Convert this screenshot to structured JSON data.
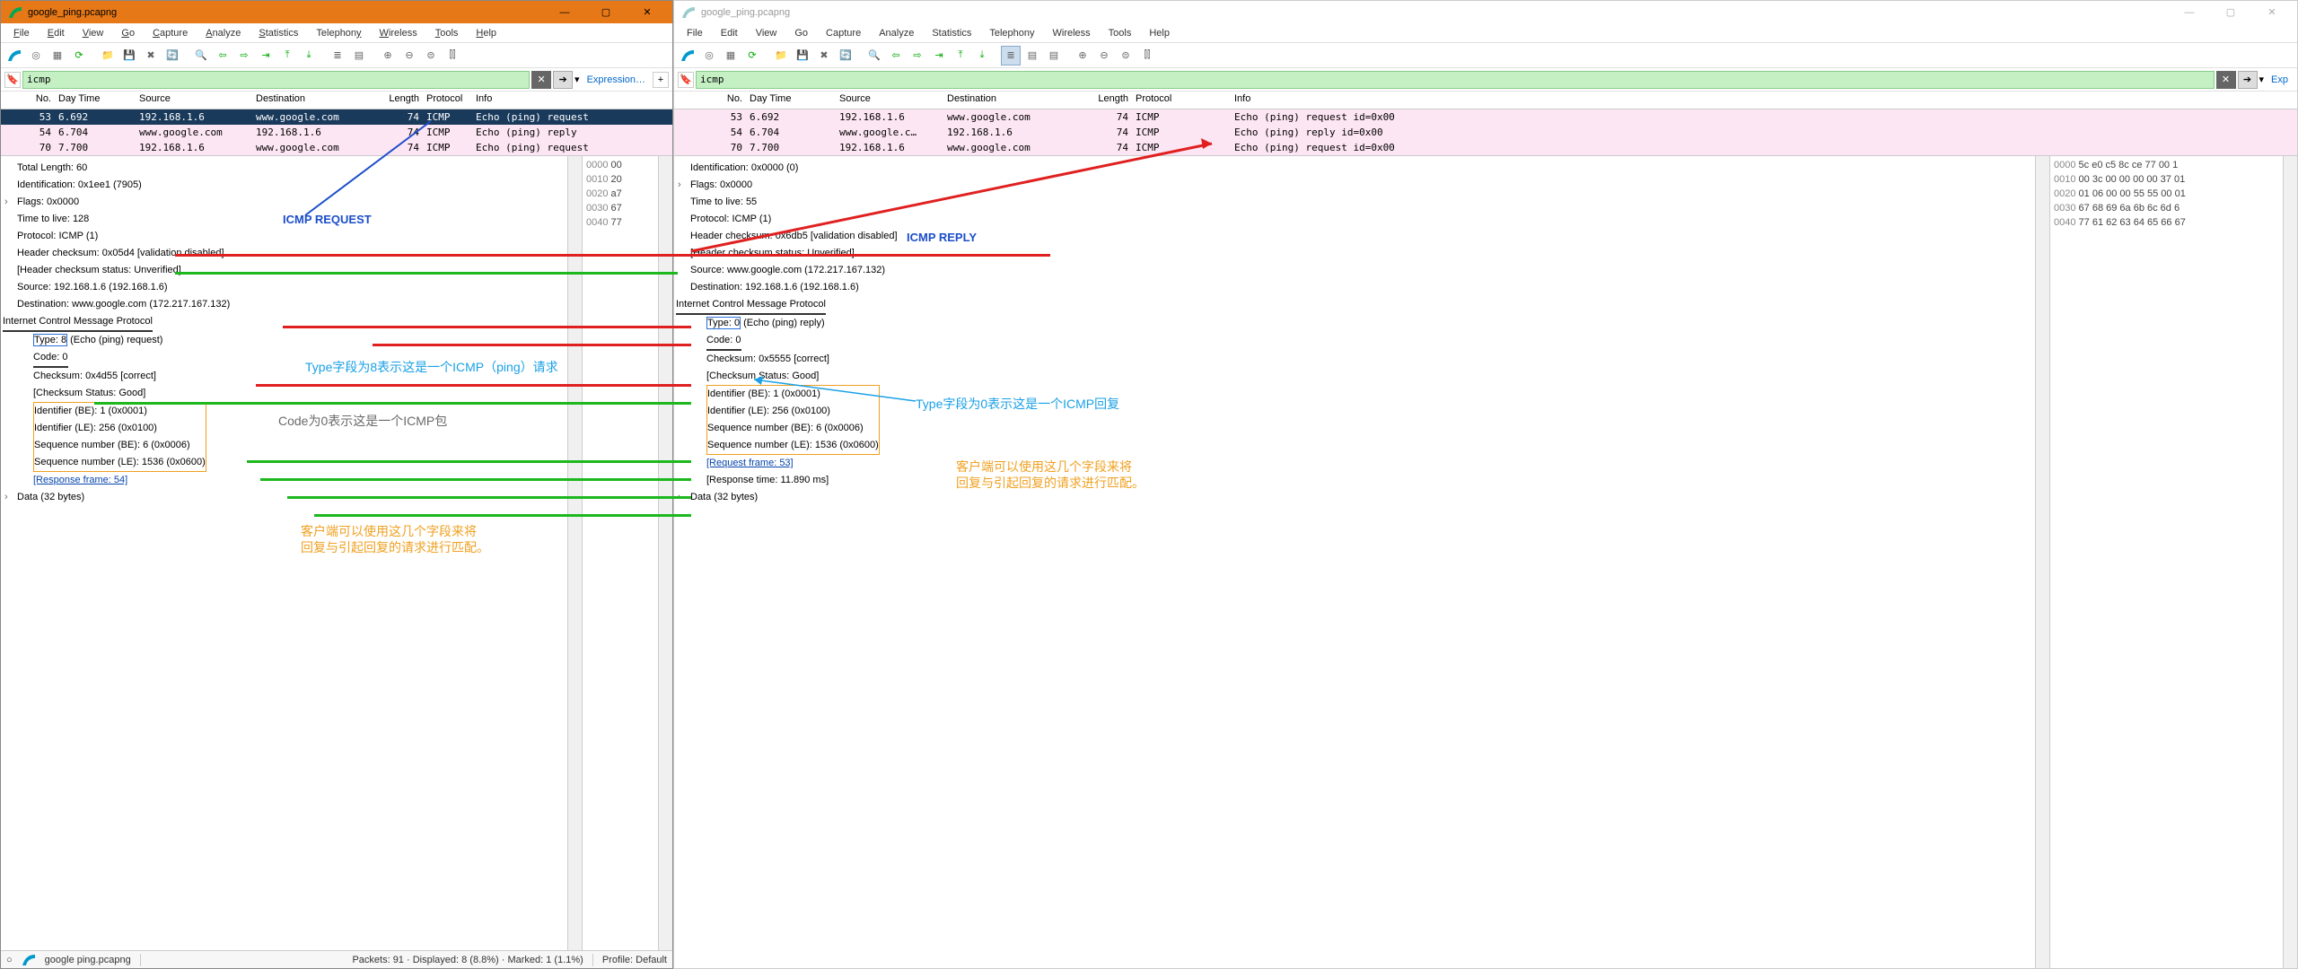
{
  "shared": {
    "title": "google_ping.pcapng",
    "menus": [
      "File",
      "Edit",
      "View",
      "Go",
      "Capture",
      "Analyze",
      "Statistics",
      "Telephony",
      "Wireless",
      "Tools",
      "Help"
    ],
    "filter_value": "icmp",
    "filter_expr": "Expression…",
    "columns": [
      "No.",
      "Day Time",
      "Source",
      "Destination",
      "Length",
      "Protocol",
      "Info"
    ]
  },
  "left": {
    "packets": [
      {
        "no": "53",
        "day": "6.692",
        "src": "192.168.1.6",
        "dst": "www.google.com",
        "len": "74",
        "proto": "ICMP",
        "info": "Echo (ping) request",
        "sel": true
      },
      {
        "no": "54",
        "day": "6.704",
        "src": "www.google.com",
        "dst": "192.168.1.6",
        "len": "74",
        "proto": "ICMP",
        "info": "Echo (ping) reply",
        "pink": true
      },
      {
        "no": "70",
        "day": "7.700",
        "src": "192.168.1.6",
        "dst": "www.google.com",
        "len": "74",
        "proto": "ICMP",
        "info": "Echo (ping) request",
        "pink": true
      }
    ],
    "tree": {
      "l0": "Total Length: 60",
      "l1": "Identification: 0x1ee1 (7905)",
      "l2": "Flags: 0x0000",
      "l3": "Time to live: 128",
      "l4": "Protocol: ICMP (1)",
      "l5": "Header checksum: 0x05d4 [validation disabled]",
      "l6": "[Header checksum status: Unverified]",
      "l7": "Source: 192.168.1.6 (192.168.1.6)",
      "l8": "Destination: www.google.com (172.217.167.132)",
      "l9": "Internet Control Message Protocol",
      "l10": "Type: 8",
      "l10b": " (Echo (ping) request)",
      "l11": "Code: 0",
      "l12": "Checksum: 0x4d55 [correct]",
      "l13": "[Checksum Status: Good]",
      "l14": "Identifier (BE): 1 (0x0001)",
      "l15": "Identifier (LE): 256 (0x0100)",
      "l16": "Sequence number (BE): 6 (0x0006)",
      "l17": "Sequence number (LE): 1536 (0x0600)",
      "l18": "[Response frame: 54]",
      "l19": "Data (32 bytes)"
    },
    "hex": [
      {
        "off": "0000",
        "b": "00"
      },
      {
        "off": "0010",
        "b": "20"
      },
      {
        "off": "0020",
        "b": "a7"
      },
      {
        "off": "0030",
        "b": "67"
      },
      {
        "off": "0040",
        "b": "77"
      }
    ],
    "status_file": "google ping.pcapng",
    "status_pkts": "Packets: 91 · Displayed: 8 (8.8%) · Marked: 1 (1.1%)",
    "status_profile": "Profile: Default"
  },
  "right": {
    "packets": [
      {
        "no": "53",
        "day": "6.692",
        "src": "192.168.1.6",
        "dst": "www.google.com",
        "len": "74",
        "proto": "ICMP",
        "info": "Echo (ping) request  id=0x00",
        "pink": true
      },
      {
        "no": "54",
        "day": "6.704",
        "src": "www.google.c…",
        "dst": "192.168.1.6",
        "len": "74",
        "proto": "ICMP",
        "info": "Echo (ping) reply    id=0x00",
        "pink": true
      },
      {
        "no": "70",
        "day": "7.700",
        "src": "192.168.1.6",
        "dst": "www.google.com",
        "len": "74",
        "proto": "ICMP",
        "info": "Echo (ping) request  id=0x00",
        "pink": true
      }
    ],
    "tree": {
      "l1": "Identification: 0x0000 (0)",
      "l2": "Flags: 0x0000",
      "l3": "Time to live: 55",
      "l4": "Protocol: ICMP (1)",
      "l5": "Header checksum: 0x6db5 [validation disabled]",
      "l6": "[Header checksum status: Unverified]",
      "l7": "Source: www.google.com (172.217.167.132)",
      "l8": "Destination: 192.168.1.6 (192.168.1.6)",
      "l9": "Internet Control Message Protocol",
      "l10": "Type: 0",
      "l10b": " (Echo (ping) reply)",
      "l11": "Code: 0",
      "l12": "Checksum: 0x5555 [correct]",
      "l13": "[Checksum Status: Good]",
      "l14": "Identifier (BE): 1 (0x0001)",
      "l15": "Identifier (LE): 256 (0x0100)",
      "l16": "Sequence number (BE): 6 (0x0006)",
      "l17": "Sequence number (LE): 1536 (0x0600)",
      "l18": "[Request frame: 53]",
      "l19": "[Response time: 11.890 ms]",
      "l20": "Data (32 bytes)"
    },
    "hex": [
      {
        "off": "0000",
        "b": "5c e0 c5 8c ce 77 00 1"
      },
      {
        "off": "0010",
        "b": "00 3c 00 00 00 00 37 01"
      },
      {
        "off": "0020",
        "b": "01 06 00 00 55 55 00 01"
      },
      {
        "off": "0030",
        "b": "67 68 69 6a 6b 6c 6d 6"
      },
      {
        "off": "0040",
        "b": "77 61 62 63 64 65 66 67"
      }
    ]
  },
  "annotations": {
    "icmp_request": "ICMP REQUEST",
    "icmp_reply": "ICMP REPLY",
    "type8": "Type字段为8表示这是一个ICMP（ping）请求",
    "type0": "Type字段为0表示这是一个ICMP回复",
    "code0": "Code为0表示这是一个ICMP包",
    "match1": "客户端可以使用这几个字段来将",
    "match2": "回复与引起回复的请求进行匹配。"
  }
}
